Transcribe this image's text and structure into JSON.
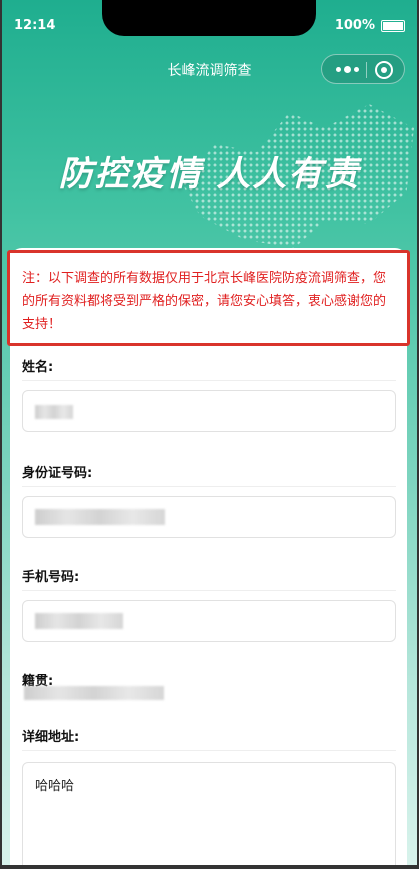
{
  "status": {
    "time": "12:14",
    "battery": "100%"
  },
  "nav": {
    "title": "长峰流调筛查"
  },
  "banner": {
    "text": "防控疫情  人人有责"
  },
  "notice": {
    "text": "注：以下调查的所有数据仅用于北京长峰医院防疫流调筛查，您的所有资料都将受到严格的保密，请您安心填答，衷心感谢您的支持！"
  },
  "form": {
    "name_label": "姓名:",
    "id_label": "身份证号码:",
    "phone_label": "手机号码:",
    "origin_label": "籍贯:",
    "address_label": "详细地址:",
    "address_value": "哈哈哈"
  }
}
